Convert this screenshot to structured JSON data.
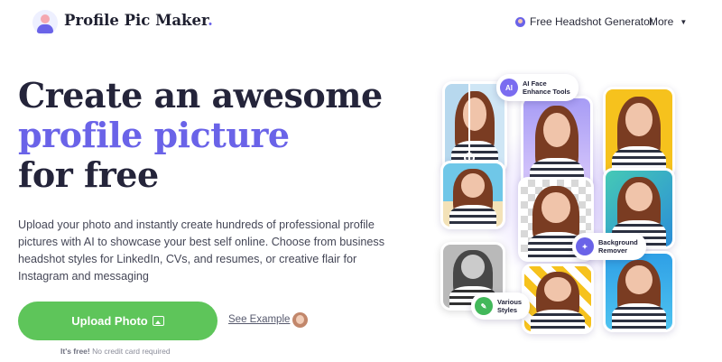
{
  "header": {
    "logo_text": "Profile Pic Maker",
    "logo_dot": ".",
    "nav_link": "Free Headshot Generator",
    "nav_more": "More",
    "nav_more_caret": "▼"
  },
  "hero": {
    "title_line1": "Create an awesome",
    "title_line2": "profile picture",
    "title_line3": "for free",
    "description": "Upload your photo and instantly create hundreds of professional profile pictures with AI to showcase your best self online. Choose from business headshot styles for LinkedIn, CVs, and resumes, or creative flair for Instagram and messaging",
    "upload_label": "Upload Photo",
    "see_example": "See Example",
    "free_bold": "It's free!",
    "free_rest": " No credit card required"
  },
  "badges": {
    "ai_icon": "AI",
    "ai_line1": "AI Face",
    "ai_line2": "Enhance Tools",
    "bg_line1": "Background",
    "bg_line2": "Remover",
    "styles_line1": "Various",
    "styles_line2": "Styles"
  },
  "colors": {
    "accent": "#6a63e8",
    "cta_green": "#5ec55a",
    "heading": "#24243a"
  },
  "icons": [
    "headshot-icon",
    "chevron-down-icon",
    "photo-icon",
    "ai-icon",
    "magic-wand-icon",
    "brush-icon"
  ]
}
